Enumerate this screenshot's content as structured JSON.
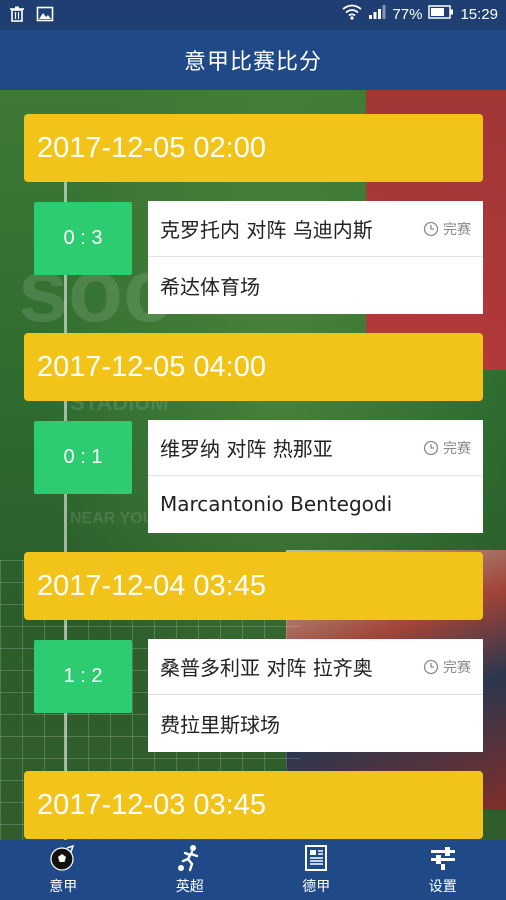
{
  "status_bar": {
    "battery_percent": "77%",
    "time": "15:29",
    "icons": [
      "trash-icon",
      "image-icon",
      "wifi-icon",
      "signal-icon",
      "battery-icon"
    ]
  },
  "header": {
    "title": "意甲比赛比分"
  },
  "matches": [
    {
      "datetime": "2017-12-05 02:00",
      "score": "0 : 3",
      "teams": "克罗托内 对阵 乌迪内斯",
      "status": "完赛",
      "venue": "希达体育场"
    },
    {
      "datetime": "2017-12-05 04:00",
      "score": "0 : 1",
      "teams": "维罗纳 对阵 热那亚",
      "status": "完赛",
      "venue": "Marcantonio Bentegodi"
    },
    {
      "datetime": "2017-12-04 03:45",
      "score": "1 : 2",
      "teams": "桑普多利亚 对阵 拉齐奥",
      "status": "完赛",
      "venue": "费拉里斯球场"
    },
    {
      "datetime": "2017-12-03 03:45"
    }
  ],
  "tabs": [
    {
      "label": "意甲",
      "icon": "soccer-ball-icon"
    },
    {
      "label": "英超",
      "icon": "player-kick-icon"
    },
    {
      "label": "德甲",
      "icon": "newspaper-icon"
    },
    {
      "label": "设置",
      "icon": "settings-icon"
    }
  ],
  "colors": {
    "header_bg": "#1f4a87",
    "date_bar": "#f2c41a",
    "score_box": "#2ecc71",
    "card_bg": "#ffffff"
  }
}
